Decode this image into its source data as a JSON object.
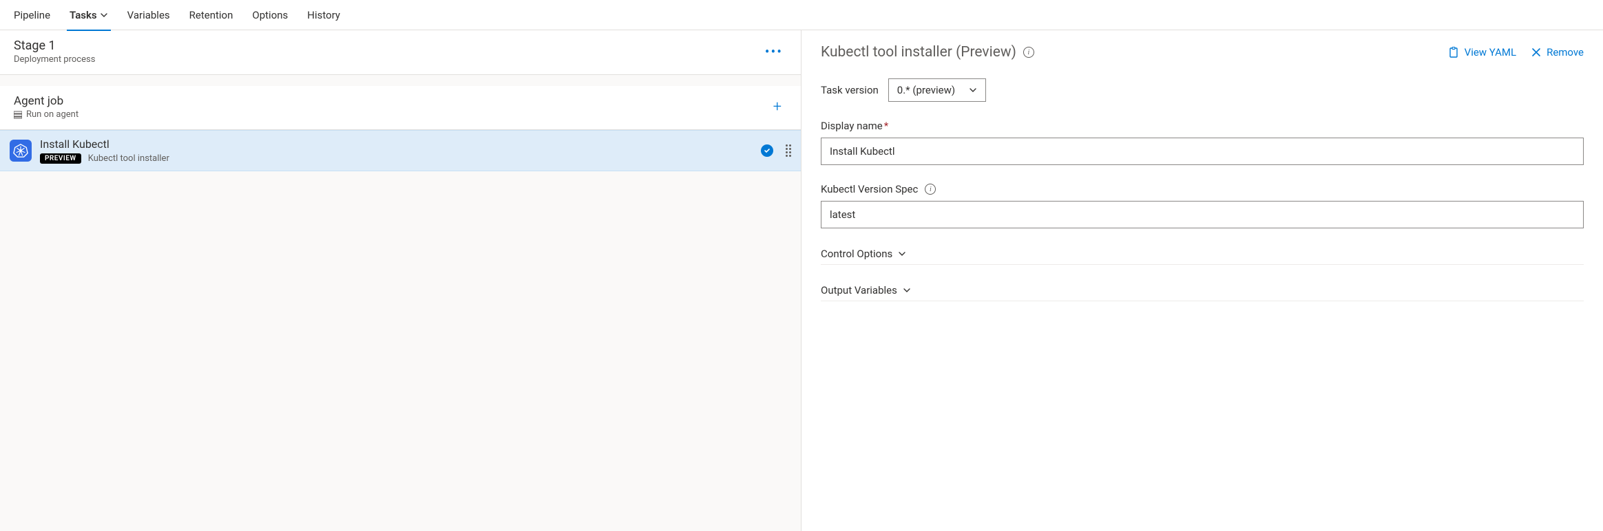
{
  "tabs": {
    "pipeline": "Pipeline",
    "tasks": "Tasks",
    "variables": "Variables",
    "retention": "Retention",
    "options": "Options",
    "history": "History"
  },
  "stage": {
    "title": "Stage 1",
    "subtitle": "Deployment process"
  },
  "agentJob": {
    "title": "Agent job",
    "subtitle": "Run on agent"
  },
  "task": {
    "title": "Install Kubectl",
    "badge": "PREVIEW",
    "desc": "Kubectl tool installer"
  },
  "detail": {
    "title": "Kubectl tool installer (Preview)",
    "viewYaml": "View YAML",
    "remove": "Remove",
    "taskVersionLabel": "Task version",
    "taskVersionValue": "0.* (preview)",
    "displayNameLabel": "Display name",
    "displayNameValue": "Install Kubectl",
    "versionSpecLabel": "Kubectl Version Spec",
    "versionSpecValue": "latest",
    "controlOptions": "Control Options",
    "outputVariables": "Output Variables"
  }
}
